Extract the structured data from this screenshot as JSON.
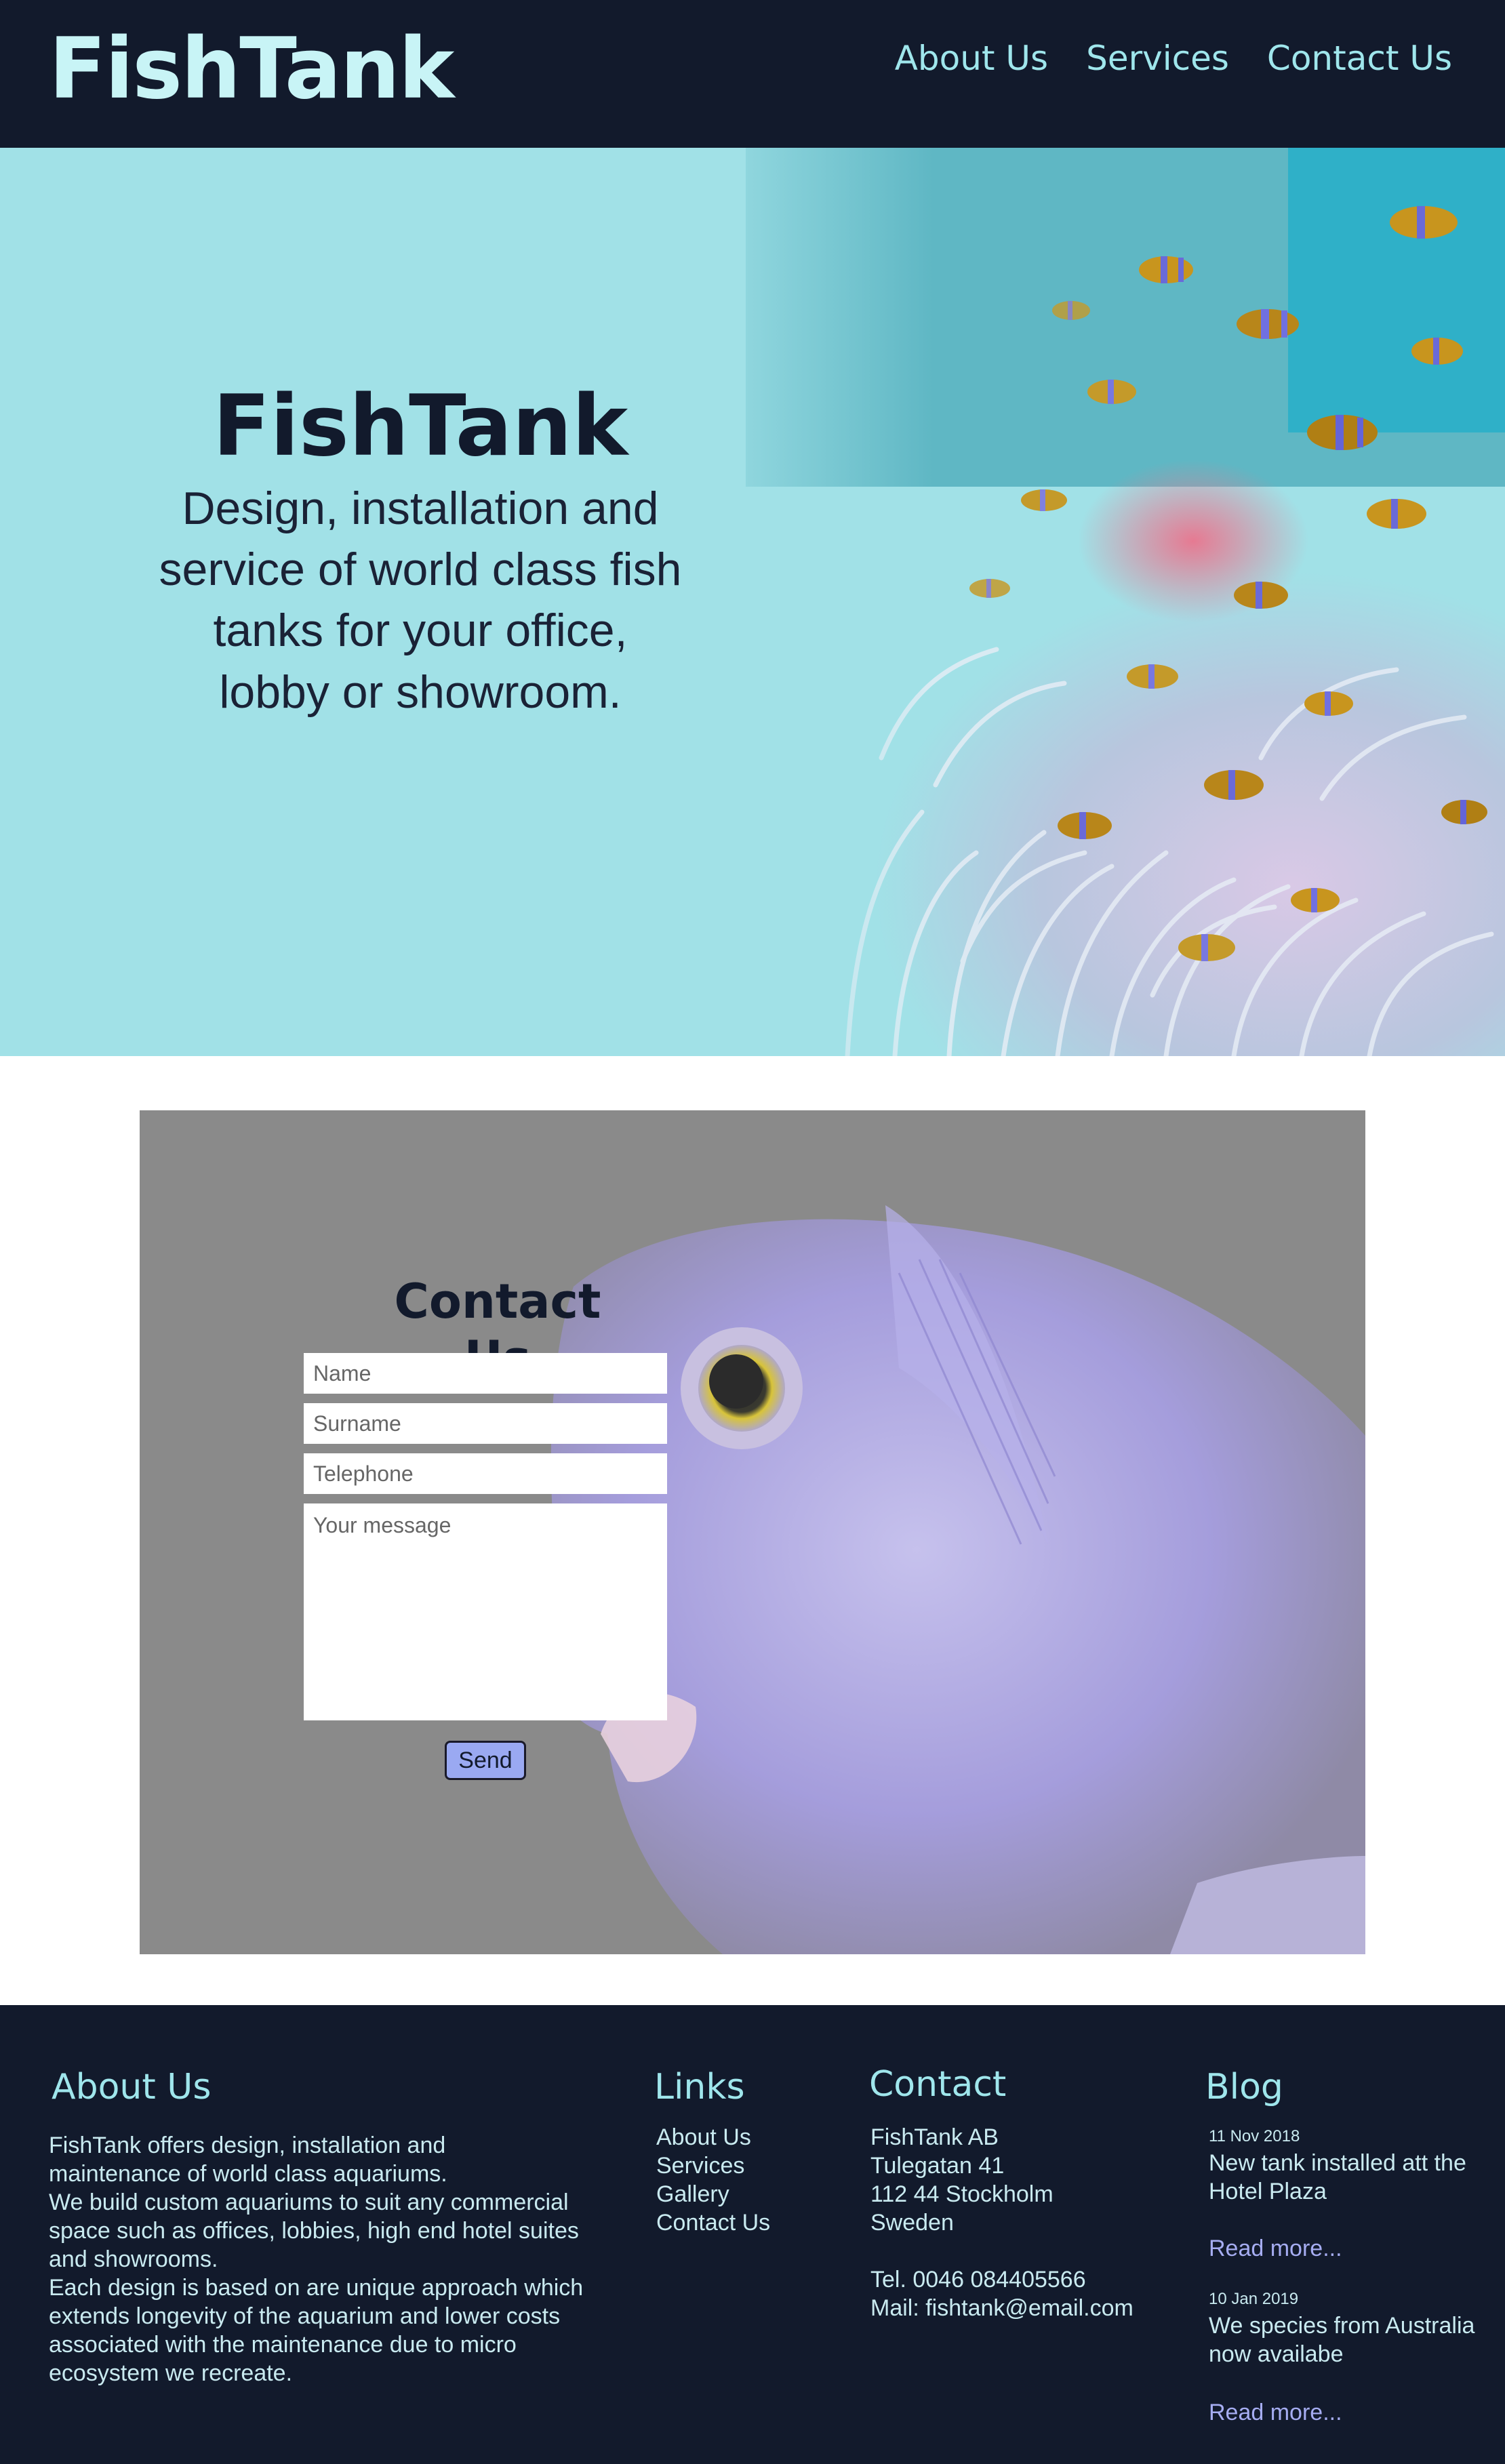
{
  "header": {
    "logo": "FishTank",
    "nav": [
      {
        "label": "About Us"
      },
      {
        "label": "Services"
      },
      {
        "label": "Contact Us"
      }
    ]
  },
  "hero": {
    "title": "FishTank",
    "subtitle_lines": [
      "Design, installation and",
      "service of world class fish",
      "tanks for your office,",
      "lobby or showroom."
    ]
  },
  "contact": {
    "title": "Contact Us",
    "placeholders": {
      "name": "Name",
      "surname": "Surname",
      "telephone": "Telephone",
      "message": "Your message"
    },
    "send_label": "Send"
  },
  "footer": {
    "about": {
      "heading": "About Us",
      "lines": [
        "FishTank offers design, installation and",
        "maintenance of world class aquariums.",
        "We build custom aquariums to suit any commercial",
        "space such as offices, lobbies, high end hotel suites",
        "and showrooms.",
        "Each design is based on are unique approach which",
        "extends longevity of the aquarium and lower costs",
        "associated with the maintenance due to micro",
        "ecosystem we recreate."
      ]
    },
    "links": {
      "heading": "Links",
      "items": [
        "About Us",
        "Services",
        "Gallery",
        "Contact Us"
      ]
    },
    "contact": {
      "heading": "Contact",
      "address": [
        "FishTank AB",
        "Tulegatan 41",
        "112 44 Stockholm",
        "Sweden"
      ],
      "phone": "Tel. 0046 084405566",
      "mail": "Mail: fishtank@email.com"
    },
    "blog": {
      "heading": "Blog",
      "posts": [
        {
          "date": "11 Nov 2018",
          "title_lines": [
            "New tank installed att the",
            "Hotel Plaza"
          ],
          "read_more": "Read more..."
        },
        {
          "date": "10 Jan 2019",
          "title_lines": [
            "We species from Australia",
            "now availabe"
          ],
          "read_more": "Read more..."
        }
      ]
    }
  },
  "colors": {
    "header_bg": "#121a2c",
    "hero_bg": "#a1e1e7",
    "accent": "#9fe6ec",
    "contact_bg": "#8a8a8a",
    "send_button": "#9aa9f2",
    "read_more": "#a6adf2"
  },
  "images": {
    "hero": "clownfish-anemone-photo",
    "contact": "purple-fish-closeup-photo"
  }
}
